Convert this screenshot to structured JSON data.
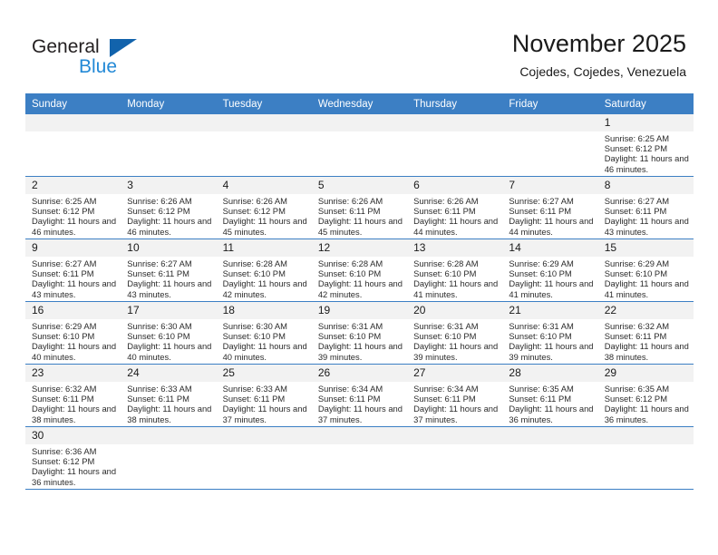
{
  "brand": {
    "name_dark": "General",
    "name_light": "Blue",
    "flag_icon": "blue-flag-triangle",
    "dark_color": "#231f20",
    "light_color": "#2389d6",
    "flag_color": "#1263ac"
  },
  "header": {
    "title": "November 2025",
    "subtitle": "Cojedes, Cojedes, Venezuela"
  },
  "theme": {
    "header_row_bg": "#3c7fc4",
    "daynum_bg": "#f2f2f2",
    "grid_line": "#3c7fc4",
    "text": "#1a1a1a"
  },
  "weekdays": [
    "Sunday",
    "Monday",
    "Tuesday",
    "Wednesday",
    "Thursday",
    "Friday",
    "Saturday"
  ],
  "labels": {
    "sunrise_prefix": "Sunrise:",
    "sunset_prefix": "Sunset:",
    "daylight_prefix": "Daylight:"
  },
  "weeks": [
    [
      {
        "blank": true
      },
      {
        "blank": true
      },
      {
        "blank": true
      },
      {
        "blank": true
      },
      {
        "blank": true
      },
      {
        "blank": true
      },
      {
        "day": "1",
        "sunrise": "Sunrise: 6:25 AM",
        "sunset": "Sunset: 6:12 PM",
        "daylight": "Daylight: 11 hours and 46 minutes."
      }
    ],
    [
      {
        "day": "2",
        "sunrise": "Sunrise: 6:25 AM",
        "sunset": "Sunset: 6:12 PM",
        "daylight": "Daylight: 11 hours and 46 minutes."
      },
      {
        "day": "3",
        "sunrise": "Sunrise: 6:26 AM",
        "sunset": "Sunset: 6:12 PM",
        "daylight": "Daylight: 11 hours and 46 minutes."
      },
      {
        "day": "4",
        "sunrise": "Sunrise: 6:26 AM",
        "sunset": "Sunset: 6:12 PM",
        "daylight": "Daylight: 11 hours and 45 minutes."
      },
      {
        "day": "5",
        "sunrise": "Sunrise: 6:26 AM",
        "sunset": "Sunset: 6:11 PM",
        "daylight": "Daylight: 11 hours and 45 minutes."
      },
      {
        "day": "6",
        "sunrise": "Sunrise: 6:26 AM",
        "sunset": "Sunset: 6:11 PM",
        "daylight": "Daylight: 11 hours and 44 minutes."
      },
      {
        "day": "7",
        "sunrise": "Sunrise: 6:27 AM",
        "sunset": "Sunset: 6:11 PM",
        "daylight": "Daylight: 11 hours and 44 minutes."
      },
      {
        "day": "8",
        "sunrise": "Sunrise: 6:27 AM",
        "sunset": "Sunset: 6:11 PM",
        "daylight": "Daylight: 11 hours and 43 minutes."
      }
    ],
    [
      {
        "day": "9",
        "sunrise": "Sunrise: 6:27 AM",
        "sunset": "Sunset: 6:11 PM",
        "daylight": "Daylight: 11 hours and 43 minutes."
      },
      {
        "day": "10",
        "sunrise": "Sunrise: 6:27 AM",
        "sunset": "Sunset: 6:11 PM",
        "daylight": "Daylight: 11 hours and 43 minutes."
      },
      {
        "day": "11",
        "sunrise": "Sunrise: 6:28 AM",
        "sunset": "Sunset: 6:10 PM",
        "daylight": "Daylight: 11 hours and 42 minutes."
      },
      {
        "day": "12",
        "sunrise": "Sunrise: 6:28 AM",
        "sunset": "Sunset: 6:10 PM",
        "daylight": "Daylight: 11 hours and 42 minutes."
      },
      {
        "day": "13",
        "sunrise": "Sunrise: 6:28 AM",
        "sunset": "Sunset: 6:10 PM",
        "daylight": "Daylight: 11 hours and 41 minutes."
      },
      {
        "day": "14",
        "sunrise": "Sunrise: 6:29 AM",
        "sunset": "Sunset: 6:10 PM",
        "daylight": "Daylight: 11 hours and 41 minutes."
      },
      {
        "day": "15",
        "sunrise": "Sunrise: 6:29 AM",
        "sunset": "Sunset: 6:10 PM",
        "daylight": "Daylight: 11 hours and 41 minutes."
      }
    ],
    [
      {
        "day": "16",
        "sunrise": "Sunrise: 6:29 AM",
        "sunset": "Sunset: 6:10 PM",
        "daylight": "Daylight: 11 hours and 40 minutes."
      },
      {
        "day": "17",
        "sunrise": "Sunrise: 6:30 AM",
        "sunset": "Sunset: 6:10 PM",
        "daylight": "Daylight: 11 hours and 40 minutes."
      },
      {
        "day": "18",
        "sunrise": "Sunrise: 6:30 AM",
        "sunset": "Sunset: 6:10 PM",
        "daylight": "Daylight: 11 hours and 40 minutes."
      },
      {
        "day": "19",
        "sunrise": "Sunrise: 6:31 AM",
        "sunset": "Sunset: 6:10 PM",
        "daylight": "Daylight: 11 hours and 39 minutes."
      },
      {
        "day": "20",
        "sunrise": "Sunrise: 6:31 AM",
        "sunset": "Sunset: 6:10 PM",
        "daylight": "Daylight: 11 hours and 39 minutes."
      },
      {
        "day": "21",
        "sunrise": "Sunrise: 6:31 AM",
        "sunset": "Sunset: 6:10 PM",
        "daylight": "Daylight: 11 hours and 39 minutes."
      },
      {
        "day": "22",
        "sunrise": "Sunrise: 6:32 AM",
        "sunset": "Sunset: 6:11 PM",
        "daylight": "Daylight: 11 hours and 38 minutes."
      }
    ],
    [
      {
        "day": "23",
        "sunrise": "Sunrise: 6:32 AM",
        "sunset": "Sunset: 6:11 PM",
        "daylight": "Daylight: 11 hours and 38 minutes."
      },
      {
        "day": "24",
        "sunrise": "Sunrise: 6:33 AM",
        "sunset": "Sunset: 6:11 PM",
        "daylight": "Daylight: 11 hours and 38 minutes."
      },
      {
        "day": "25",
        "sunrise": "Sunrise: 6:33 AM",
        "sunset": "Sunset: 6:11 PM",
        "daylight": "Daylight: 11 hours and 37 minutes."
      },
      {
        "day": "26",
        "sunrise": "Sunrise: 6:34 AM",
        "sunset": "Sunset: 6:11 PM",
        "daylight": "Daylight: 11 hours and 37 minutes."
      },
      {
        "day": "27",
        "sunrise": "Sunrise: 6:34 AM",
        "sunset": "Sunset: 6:11 PM",
        "daylight": "Daylight: 11 hours and 37 minutes."
      },
      {
        "day": "28",
        "sunrise": "Sunrise: 6:35 AM",
        "sunset": "Sunset: 6:11 PM",
        "daylight": "Daylight: 11 hours and 36 minutes."
      },
      {
        "day": "29",
        "sunrise": "Sunrise: 6:35 AM",
        "sunset": "Sunset: 6:12 PM",
        "daylight": "Daylight: 11 hours and 36 minutes."
      }
    ],
    [
      {
        "day": "30",
        "sunrise": "Sunrise: 6:36 AM",
        "sunset": "Sunset: 6:12 PM",
        "daylight": "Daylight: 11 hours and 36 minutes."
      },
      {
        "blank": true
      },
      {
        "blank": true
      },
      {
        "blank": true
      },
      {
        "blank": true
      },
      {
        "blank": true
      },
      {
        "blank": true
      }
    ]
  ]
}
